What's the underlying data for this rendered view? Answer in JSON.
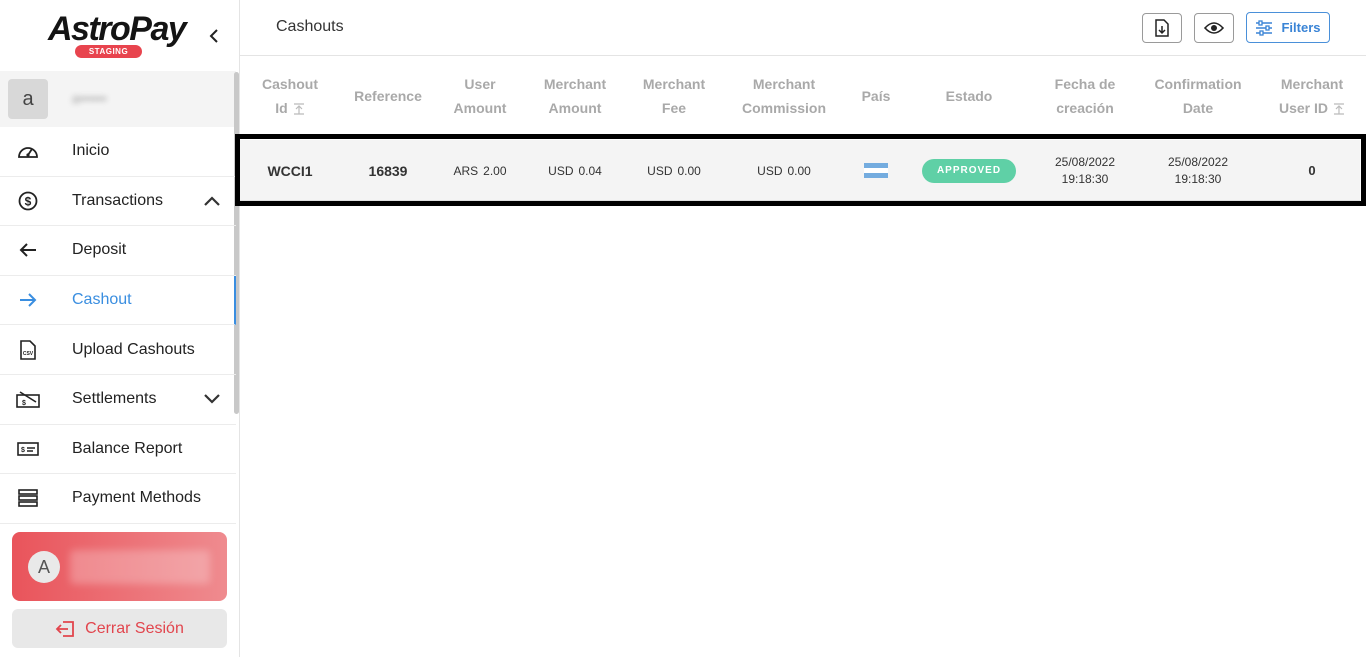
{
  "brand": {
    "name": "AstroPay",
    "env_badge": "STAGING"
  },
  "user": {
    "initial": "a",
    "name": "a••••••"
  },
  "nav": {
    "items": [
      {
        "label": "Inicio",
        "icon": "speedometer-icon"
      },
      {
        "label": "Transactions",
        "icon": "dollar-circle-icon",
        "expanded": true
      },
      {
        "label": "Deposit",
        "icon": "arrow-left-icon"
      },
      {
        "label": "Cashout",
        "icon": "arrow-right-icon",
        "active": true
      },
      {
        "label": "Upload Cashouts",
        "icon": "csv-file-icon"
      },
      {
        "label": "Settlements",
        "icon": "settlement-icon",
        "expanded": false
      },
      {
        "label": "Balance Report",
        "icon": "balance-card-icon"
      },
      {
        "label": "Payment Methods",
        "icon": "payment-methods-icon"
      }
    ]
  },
  "account": {
    "initial": "A"
  },
  "logout": {
    "label": "Cerrar Sesión"
  },
  "header": {
    "title": "Cashouts",
    "filters_label": "Filters"
  },
  "table": {
    "columns": [
      {
        "line1": "Cashout",
        "line2": "Id",
        "sortable": true
      },
      {
        "line1": "Reference",
        "line2": ""
      },
      {
        "line1": "User",
        "line2": "Amount"
      },
      {
        "line1": "Merchant",
        "line2": "Amount"
      },
      {
        "line1": "Merchant",
        "line2": "Fee"
      },
      {
        "line1": "Merchant",
        "line2": "Commission"
      },
      {
        "line1": "País",
        "line2": ""
      },
      {
        "line1": "Estado",
        "line2": ""
      },
      {
        "line1": "Fecha de",
        "line2": "creación"
      },
      {
        "line1": "Confirmation",
        "line2": "Date"
      },
      {
        "line1": "Merchant",
        "line2": "User ID",
        "sortable": true
      }
    ],
    "rows": [
      {
        "cashout_id": "WCCI1",
        "reference": "16839",
        "user_amount": {
          "currency": "ARS",
          "value": "2.00"
        },
        "merchant_amount": {
          "currency": "USD",
          "value": "0.04"
        },
        "merchant_fee": {
          "currency": "USD",
          "value": "0.00"
        },
        "merchant_commission": {
          "currency": "USD",
          "value": "0.00"
        },
        "country_flag": "argentina-flag-icon",
        "status": "APPROVED",
        "created": {
          "date": "25/08/2022",
          "time": "19:18:30"
        },
        "confirmed": {
          "date": "25/08/2022",
          "time": "19:18:30"
        },
        "merchant_user_id": "0"
      }
    ]
  },
  "colors": {
    "accent": "#3a8ee0",
    "danger": "#e2454d",
    "approved": "#5fd0a6",
    "flag_blue": "#74acdf"
  }
}
